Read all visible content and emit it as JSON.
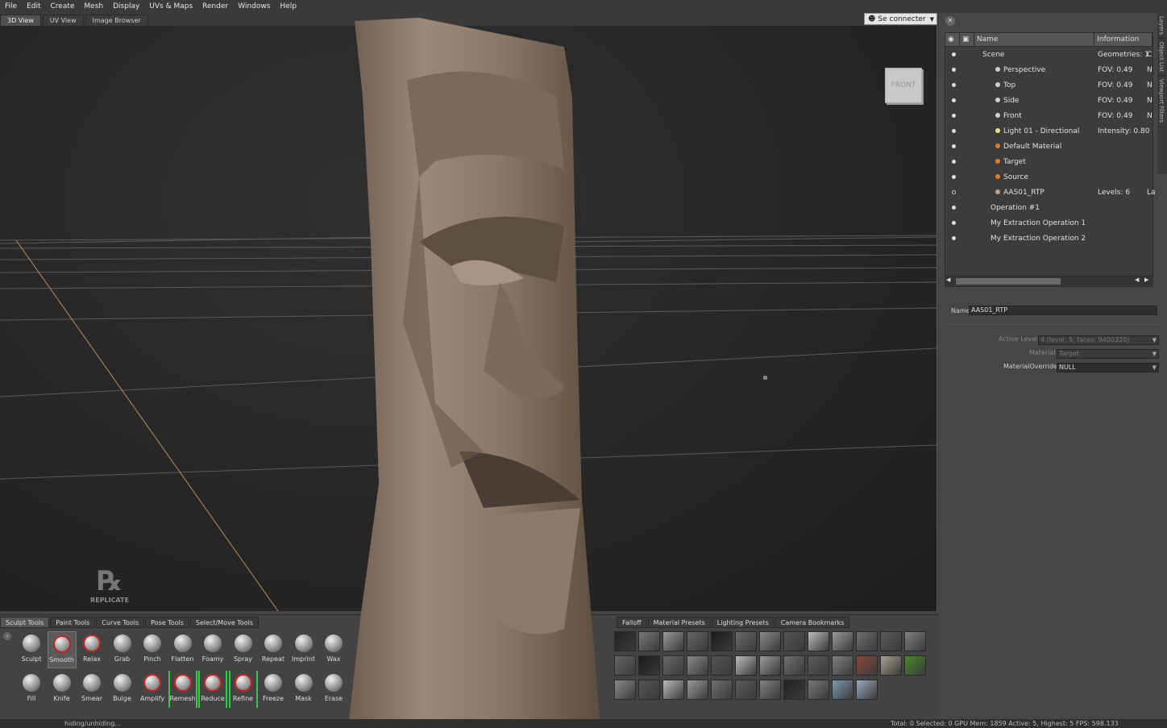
{
  "menubar": {
    "items": [
      "File",
      "Edit",
      "Create",
      "Mesh",
      "Display",
      "UVs & Maps",
      "Render",
      "Windows",
      "Help"
    ]
  },
  "view_tabs": [
    "3D View",
    "UV View",
    "Image Browser"
  ],
  "connect_label": "Se connecter",
  "navcube_label": "FRONT",
  "logo_text": "REPLICATE",
  "side_tabs": [
    "Layers",
    "Object List",
    "Viewport Filters"
  ],
  "tree": {
    "headers": {
      "name": "Name",
      "info": "Information"
    },
    "rows": [
      {
        "name": "Scene",
        "info": "Geometries: 1",
        "extra": "C",
        "indent": 46,
        "icon": "none",
        "eye": "filled"
      },
      {
        "name": "Perspective",
        "info": "FOV: 0.49",
        "extra": "N",
        "indent": 62,
        "icon": "camera",
        "eye": "filled"
      },
      {
        "name": "Top",
        "info": "FOV: 0.49",
        "extra": "N",
        "indent": 62,
        "icon": "camera",
        "eye": "filled"
      },
      {
        "name": "Side",
        "info": "FOV: 0.49",
        "extra": "N",
        "indent": 62,
        "icon": "camera",
        "eye": "filled"
      },
      {
        "name": "Front",
        "info": "FOV: 0.49",
        "extra": "N",
        "indent": 62,
        "icon": "camera",
        "eye": "filled"
      },
      {
        "name": "Light 01 - Directional",
        "info": "Intensity: 0.80",
        "extra": "",
        "indent": 62,
        "icon": "light",
        "eye": "filled"
      },
      {
        "name": "Default Material",
        "info": "",
        "extra": "",
        "indent": 62,
        "icon": "material",
        "eye": "filled"
      },
      {
        "name": "Target",
        "info": "",
        "extra": "",
        "indent": 62,
        "icon": "material",
        "eye": "filled"
      },
      {
        "name": "Source",
        "info": "",
        "extra": "",
        "indent": 62,
        "icon": "material",
        "eye": "filled"
      },
      {
        "name": "AAS01_RTP",
        "info": "Levels: 6",
        "extra": "La",
        "indent": 62,
        "icon": "mesh",
        "eye": "hollow"
      },
      {
        "name": "Operation #1",
        "info": "",
        "extra": "",
        "indent": 56,
        "icon": "none",
        "eye": "filled"
      },
      {
        "name": "My Extraction Operation 1",
        "info": "",
        "extra": "",
        "indent": 56,
        "icon": "none",
        "eye": "filled"
      },
      {
        "name": "My Extraction Operation 2",
        "info": "",
        "extra": "",
        "indent": 56,
        "icon": "none",
        "eye": "filled"
      }
    ]
  },
  "props": {
    "name_label": "Name",
    "name_value": "AAS01_RTP",
    "active_level_label": "Active Level",
    "active_level_value": "4 (level: 5, faces: 9400320)",
    "material_label": "Material",
    "material_value": "Target",
    "override_label": "MaterialOverride",
    "override_value": "NULL"
  },
  "bottom_tabs": [
    "Sculpt Tools",
    "Paint Tools",
    "Curve Tools",
    "Pose Tools",
    "Select/Move Tools"
  ],
  "preset_tabs": [
    "Falloff",
    "Material Presets",
    "Lighting Presets",
    "Camera Bookmarks"
  ],
  "tools_row1": [
    "Sculpt",
    "Smooth",
    "Relax",
    "Grab",
    "Pinch",
    "Flatten",
    "Foamy",
    "Spray",
    "Repeat",
    "Imprint",
    "Wax"
  ],
  "tools_row2": [
    "Fill",
    "Knife",
    "Smear",
    "Bulge",
    "Amplify",
    "Remesh",
    "Reduce",
    "Refine",
    "Freeze",
    "Mask",
    "Erase"
  ],
  "status": {
    "left": "hiding/unhiding...",
    "right": "Total: 0  Selected: 0 GPU Mem: 1859  Active: 5, Highest: 5  FPS: 598.133"
  },
  "colors": {
    "accent_green": "#2ecc40",
    "carving": "#8a7868",
    "panel": "#464646"
  }
}
